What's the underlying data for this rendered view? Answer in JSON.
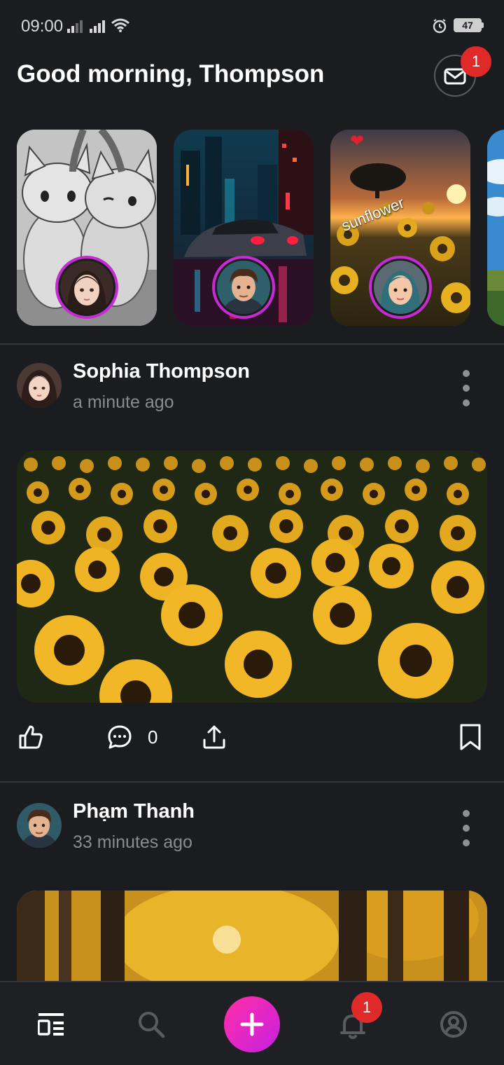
{
  "status_bar": {
    "time": "09:00",
    "battery": "47",
    "icons": [
      "signal-icon",
      "signal-icon",
      "wifi-icon",
      "alarm-icon",
      "battery-icon"
    ]
  },
  "header": {
    "greeting": "Good morning, Thompson",
    "inbox_badge": "1",
    "inbox_icon": "mail-icon"
  },
  "stories": [
    {
      "image": "kittens-sketch",
      "avatar": "sophia-avatar",
      "caption": "",
      "heart": false
    },
    {
      "image": "night-city-car",
      "avatar": "pham-avatar",
      "caption": "",
      "heart": false
    },
    {
      "image": "sunset-sunflowers",
      "avatar": "girl-avatar",
      "caption": "sunflower",
      "heart": true
    },
    {
      "image": "sky-landscape",
      "avatar": "",
      "caption": "",
      "heart": false
    }
  ],
  "posts": [
    {
      "author": "Sophia Thompson",
      "time": "a minute ago",
      "image": "sunflower-field",
      "comment_count": "0"
    },
    {
      "author": "Phạm Thanh",
      "time": "33 minutes ago",
      "image": "autumn-forest"
    }
  ],
  "bottom_nav": {
    "items": [
      "feed-icon",
      "search-icon",
      "add-icon",
      "bell-icon",
      "profile-icon"
    ],
    "notification_badge": "1"
  },
  "colors": {
    "background": "#1b1c20",
    "accent_gradient_start": "#ff2fa8",
    "accent_gradient_end": "#c81fe0",
    "badge": "#e02a2a",
    "muted_text": "#8a8b90"
  }
}
